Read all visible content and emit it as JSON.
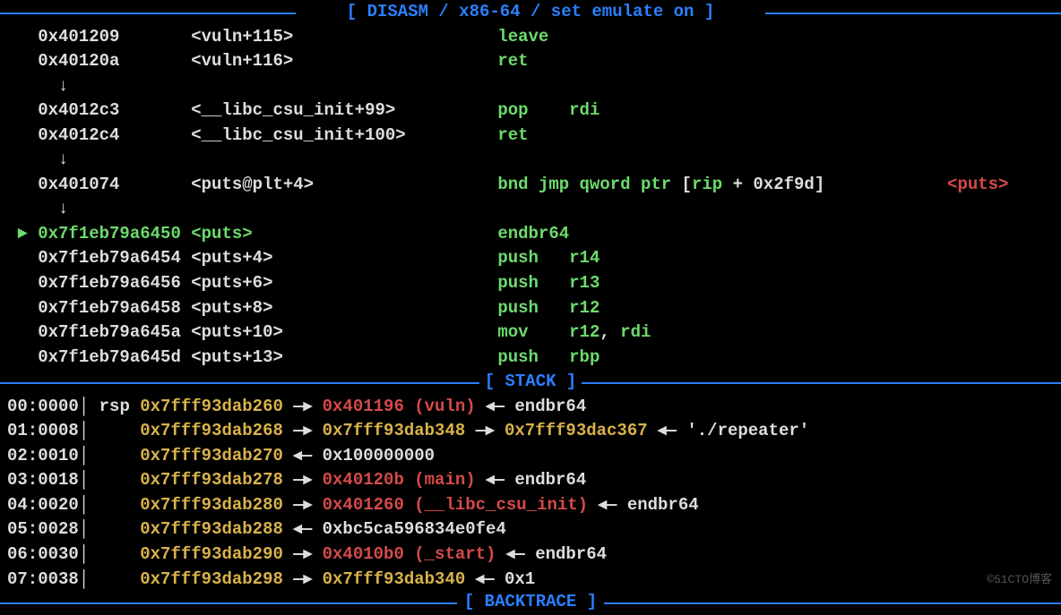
{
  "headers": {
    "disasm": "[ DISASM / x86-64 / set emulate on ]",
    "stack": "[ STACK ]",
    "backtrace": "[ BACKTRACE ]"
  },
  "disasm": [
    {
      "marker": "  ",
      "addr": "0x401209",
      "sym": "<vuln+115>",
      "instr": [
        {
          "m": "leave"
        }
      ]
    },
    {
      "marker": "  ",
      "addr": "0x40120a",
      "sym": "<vuln+116>",
      "instr": [
        {
          "m": "ret"
        }
      ]
    },
    {
      "marker": "  ",
      "addr": "  ↓",
      "sym": "",
      "instr": []
    },
    {
      "marker": "  ",
      "addr": "0x4012c3",
      "sym": "<__libc_csu_init+99>",
      "instr": [
        {
          "m": "pop"
        },
        {
          "w": "    "
        },
        {
          "r": "rdi"
        }
      ]
    },
    {
      "marker": "  ",
      "addr": "0x4012c4",
      "sym": "<__libc_csu_init+100>",
      "instr": [
        {
          "m": "ret"
        }
      ]
    },
    {
      "marker": "  ",
      "addr": "  ↓",
      "sym": "",
      "instr": []
    },
    {
      "marker": "  ",
      "addr": "0x401074",
      "sym": "<puts@plt+4>",
      "instr": [
        {
          "m": "bnd jmp qword ptr "
        },
        {
          "w": "["
        },
        {
          "r": "rip"
        },
        {
          "w": " + "
        },
        {
          "n": "0x2f9d"
        },
        {
          "w": "]"
        }
      ],
      "tail": "<puts>"
    },
    {
      "marker": "  ",
      "addr": "  ↓",
      "sym": "",
      "instr": []
    },
    {
      "marker": " ►",
      "addr": "0x7f1eb79a6450",
      "sym": "<puts>",
      "instr": [
        {
          "m": "endbr64"
        }
      ],
      "current": true
    },
    {
      "marker": "  ",
      "addr": "0x7f1eb79a6454",
      "sym": "<puts+4>",
      "instr": [
        {
          "m": "push"
        },
        {
          "w": "   "
        },
        {
          "r": "r14"
        }
      ]
    },
    {
      "marker": "  ",
      "addr": "0x7f1eb79a6456",
      "sym": "<puts+6>",
      "instr": [
        {
          "m": "push"
        },
        {
          "w": "   "
        },
        {
          "r": "r13"
        }
      ]
    },
    {
      "marker": "  ",
      "addr": "0x7f1eb79a6458",
      "sym": "<puts+8>",
      "instr": [
        {
          "m": "push"
        },
        {
          "w": "   "
        },
        {
          "r": "r12"
        }
      ]
    },
    {
      "marker": "  ",
      "addr": "0x7f1eb79a645a",
      "sym": "<puts+10>",
      "instr": [
        {
          "m": "mov"
        },
        {
          "w": "    "
        },
        {
          "r": "r12"
        },
        {
          "w": ", "
        },
        {
          "r": "rdi"
        }
      ]
    },
    {
      "marker": "  ",
      "addr": "0x7f1eb79a645d",
      "sym": "<puts+13>",
      "instr": [
        {
          "m": "push"
        },
        {
          "w": "   "
        },
        {
          "r": "rbp"
        }
      ]
    }
  ],
  "stack": [
    {
      "idx": "00",
      "off": "0000",
      "reg": "rsp",
      "addr": "0x7fff93dab260",
      "chain": [
        {
          "t": "→",
          "c": "w"
        },
        {
          "t": "0x401196 (vuln)",
          "c": "r"
        },
        {
          "t": "◂—",
          "c": "w"
        },
        {
          "t": "endbr64",
          "c": "w"
        }
      ]
    },
    {
      "idx": "01",
      "off": "0008",
      "reg": "",
      "addr": "0x7fff93dab268",
      "chain": [
        {
          "t": "→",
          "c": "w"
        },
        {
          "t": "0x7fff93dab348",
          "c": "y"
        },
        {
          "t": "→",
          "c": "w"
        },
        {
          "t": "0x7fff93dac367",
          "c": "y"
        },
        {
          "t": "◂— './repeater'",
          "c": "w"
        }
      ]
    },
    {
      "idx": "02",
      "off": "0010",
      "reg": "",
      "addr": "0x7fff93dab270",
      "chain": [
        {
          "t": "◂—",
          "c": "w"
        },
        {
          "t": "0x100000000",
          "c": "w"
        }
      ]
    },
    {
      "idx": "03",
      "off": "0018",
      "reg": "",
      "addr": "0x7fff93dab278",
      "chain": [
        {
          "t": "→",
          "c": "w"
        },
        {
          "t": "0x40120b (main)",
          "c": "r"
        },
        {
          "t": "◂—",
          "c": "w"
        },
        {
          "t": "endbr64",
          "c": "w"
        }
      ]
    },
    {
      "idx": "04",
      "off": "0020",
      "reg": "",
      "addr": "0x7fff93dab280",
      "chain": [
        {
          "t": "→",
          "c": "w"
        },
        {
          "t": "0x401260 (__libc_csu_init)",
          "c": "r"
        },
        {
          "t": "◂—",
          "c": "w"
        },
        {
          "t": "endbr64",
          "c": "w"
        }
      ]
    },
    {
      "idx": "05",
      "off": "0028",
      "reg": "",
      "addr": "0x7fff93dab288",
      "chain": [
        {
          "t": "◂—",
          "c": "w"
        },
        {
          "t": "0xbc5ca596834e0fe4",
          "c": "w"
        }
      ]
    },
    {
      "idx": "06",
      "off": "0030",
      "reg": "",
      "addr": "0x7fff93dab290",
      "chain": [
        {
          "t": "→",
          "c": "w"
        },
        {
          "t": "0x4010b0 (_start)",
          "c": "r"
        },
        {
          "t": "◂—",
          "c": "w"
        },
        {
          "t": "endbr64",
          "c": "w"
        }
      ]
    },
    {
      "idx": "07",
      "off": "0038",
      "reg": "",
      "addr": "0x7fff93dab298",
      "chain": [
        {
          "t": "→",
          "c": "w"
        },
        {
          "t": "0x7fff93dab340",
          "c": "y"
        },
        {
          "t": "◂—",
          "c": "w"
        },
        {
          "t": "0x1",
          "c": "w"
        }
      ]
    }
  ],
  "watermark": "©51CTO博客"
}
